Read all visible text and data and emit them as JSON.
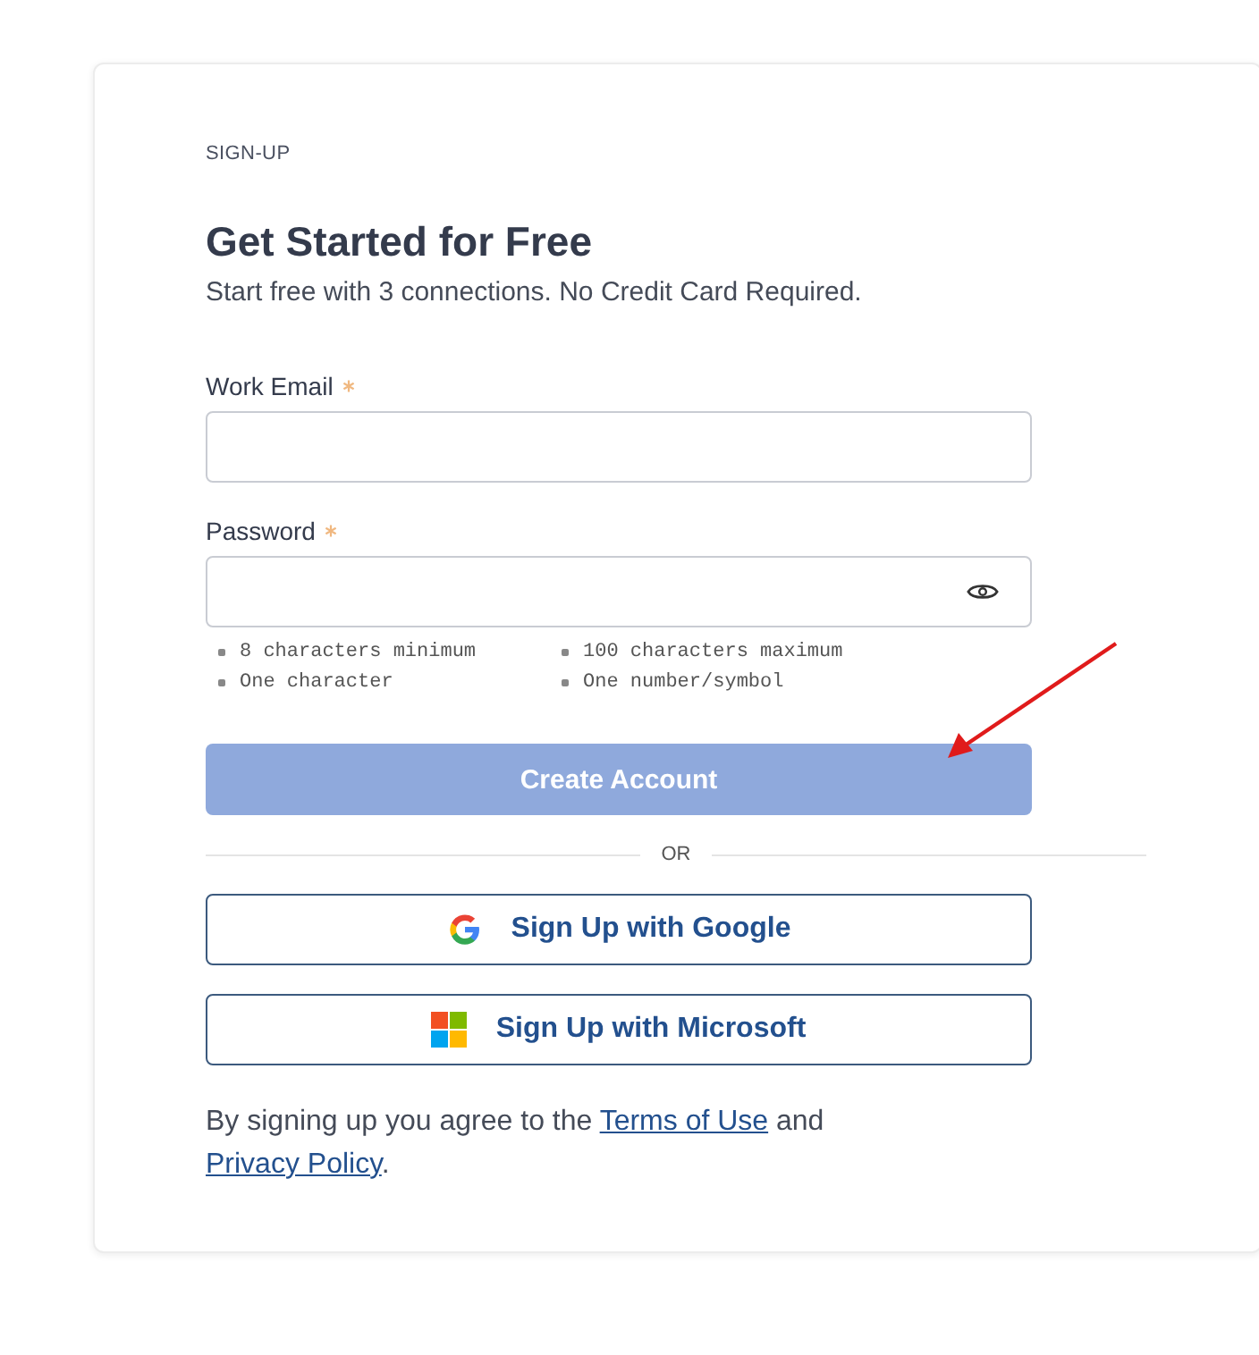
{
  "eyebrow": "SIGN-UP",
  "title": "Get Started for Free",
  "subtitle": "Start free with 3 connections. No Credit Card Required.",
  "fields": [
    {
      "label": "Work Email",
      "required": true,
      "kind": "text"
    },
    {
      "label": "Password",
      "required": true,
      "kind": "password"
    }
  ],
  "password_rules": [
    "8 characters minimum",
    "100 characters maximum",
    "One character",
    "One number/symbol"
  ],
  "submit": {
    "label": "Create Account",
    "disabled": true
  },
  "divider": "OR",
  "providers": [
    {
      "label": "Sign Up with Google",
      "kind": "google"
    },
    {
      "label": "Sign Up with Microsoft",
      "kind": "microsoft"
    }
  ],
  "legal": {
    "before": "By signing up you agree to the",
    "link1": "Terms of Use",
    "middle": "and",
    "link2": "Privacy Policy",
    "after": "."
  },
  "annotation": {
    "kind": "arrow"
  }
}
